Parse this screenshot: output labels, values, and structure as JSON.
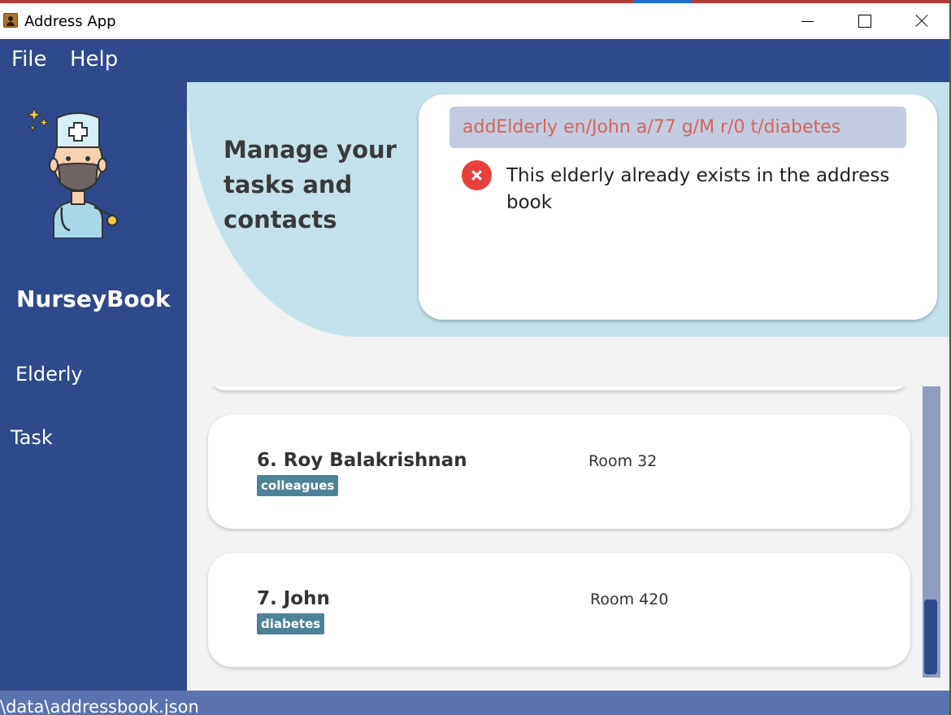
{
  "window": {
    "title": "Address App",
    "icon": "address-book-icon"
  },
  "menu": {
    "file": "File",
    "help": "Help"
  },
  "sidebar": {
    "brand": "NurseyBook",
    "logo_icon": "nurse-icon",
    "items": [
      {
        "label": "Elderly"
      },
      {
        "label": "Task"
      }
    ]
  },
  "hero": {
    "tagline": "Manage your tasks and contacts"
  },
  "command": {
    "input_value": "addElderly en/John a/77 g/M r/0 t/diabetes",
    "error_icon": "error-icon",
    "result": "This elderly already exists in the address book"
  },
  "list": {
    "cards": [
      {
        "name": "6. Roy Balakrishnan",
        "room": "Room 32",
        "tag": "colleagues"
      },
      {
        "name": "7. John",
        "room": "Room 420",
        "tag": "diabetes"
      }
    ]
  },
  "status": {
    "path": "\\data\\addressbook.json"
  },
  "colors": {
    "primary": "#2e4a8c",
    "hero": "#c5e2ec",
    "tag": "#4e8296",
    "error": "#e8413b",
    "command_text": "#d4665a",
    "status_bar": "#5b72b0"
  }
}
